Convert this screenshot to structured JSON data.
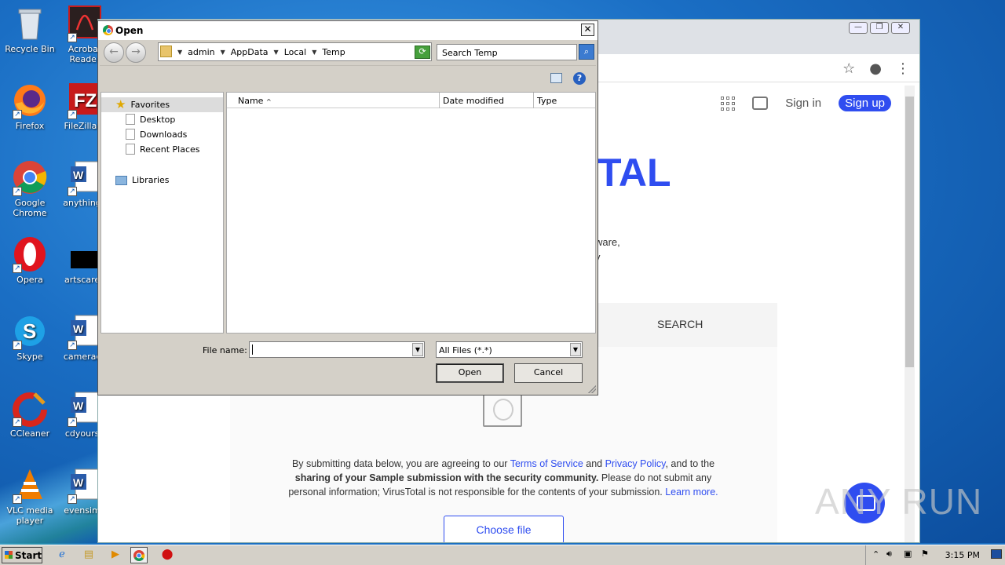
{
  "desktop": {
    "icons": [
      {
        "label": "Recycle Bin",
        "icon": "recycle-bin-icon"
      },
      {
        "label": "Acrobat Reader",
        "icon": "acrobat-icon"
      },
      {
        "label": "Firefox",
        "icon": "firefox-icon"
      },
      {
        "label": "FileZilla C",
        "icon": "filezilla-icon"
      },
      {
        "label": "Google Chrome",
        "icon": "chrome-icon"
      },
      {
        "label": "anythingh",
        "icon": "word-doc-icon"
      },
      {
        "label": "Opera",
        "icon": "opera-icon"
      },
      {
        "label": "artscaree",
        "icon": "black-file-icon"
      },
      {
        "label": "Skype",
        "icon": "skype-icon"
      },
      {
        "label": "cameraca",
        "icon": "word-doc-icon"
      },
      {
        "label": "CCleaner",
        "icon": "ccleaner-icon"
      },
      {
        "label": "cdyourse",
        "icon": "word-doc-icon"
      },
      {
        "label": "VLC media player",
        "icon": "vlc-icon"
      },
      {
        "label": "evensimp",
        "icon": "word-doc-icon"
      }
    ]
  },
  "chrome": {
    "nav": {
      "sign_in": "Sign in",
      "sign_up": "Sign up"
    },
    "logo_fragment": "TAL",
    "desc_line1": "malware,",
    "desc_line2": "unity",
    "tab_search": "SEARCH",
    "legal": {
      "p1": "By submitting data below, you are agreeing to our ",
      "tos": "Terms of Service",
      "and": " and ",
      "privacy": "Privacy Policy",
      "p2": ", and to the",
      "bold": "sharing of your Sample submission with the security community.",
      "p3": " Please do not submit any personal information; VirusTotal is not responsible for the contents of your submission. ",
      "learn": "Learn more."
    },
    "choose_file": "Choose file"
  },
  "watermark": "ANY RUN",
  "dialog": {
    "title": "Open",
    "breadcrumbs": [
      "admin",
      "AppData",
      "Local",
      "Temp"
    ],
    "search_placeholder": "Search Temp",
    "nav": {
      "favorites": "Favorites",
      "items": [
        "Desktop",
        "Downloads",
        "Recent Places"
      ],
      "libraries": "Libraries"
    },
    "columns": [
      "Name",
      "Date modified",
      "Type"
    ],
    "file_name_label": "File name:",
    "file_name_value": "",
    "file_type": "All Files (*.*)",
    "open": "Open",
    "cancel": "Cancel"
  },
  "taskbar": {
    "start": "Start",
    "time": "3:15 PM"
  },
  "colors": {
    "brand": "#2f4df0",
    "desktop": "#1a6ec4"
  }
}
